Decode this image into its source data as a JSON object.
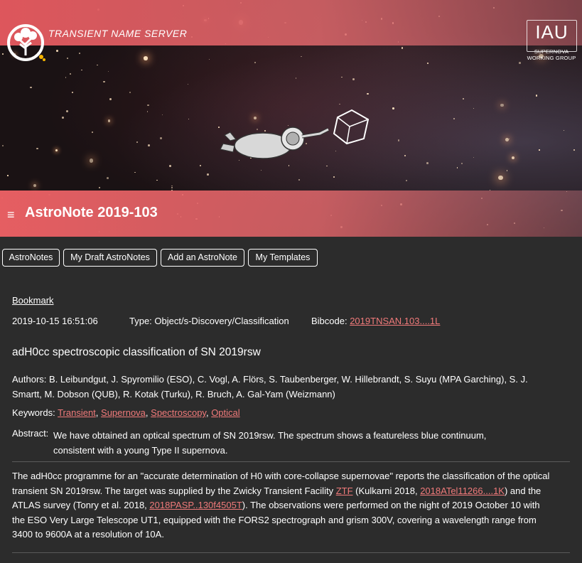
{
  "header": {
    "site_name": "TRANSIENT NAME SERVER",
    "iau_logo_text": "IAU",
    "iau_subtitle_line1": "SUPERNOVA",
    "iau_subtitle_line2": "WORKING GROUP",
    "page_title": "AstroNote 2019-103",
    "menu_icon": "≡"
  },
  "nav": {
    "buttons": [
      "AstroNotes",
      "My Draft AstroNotes",
      "Add an AstroNote",
      "My Templates"
    ]
  },
  "note": {
    "bookmark": "Bookmark",
    "datetime": "2019-10-15 16:51:06",
    "type": "Type: Object/s-Discovery/Classification",
    "bibcode_label": "Bibcode: ",
    "bibcode": "2019TNSAN.103....1L",
    "title": "adH0cc spectroscopic classification of SN 2019rsw",
    "authors_line1": "Authors: B. Leibundgut, J. Spyromilio (ESO), C. Vogl, A. Flörs, S. Taubenberger, W. Hillebrandt, S. Suyu (MPA Garching), S. J.",
    "authors_line2": "Smartt, M. Dobson (QUB), R. Kotak (Turku), R. Bruch, A. Gal-Yam (Weizmann)",
    "keywords_label": "Keywords: ",
    "keywords": [
      "Transient",
      "Supernova",
      "Spectroscopy",
      "Optical"
    ],
    "keyword_separator": ", ",
    "abstract_label": "Abstract:",
    "abstract_line1": "We have obtained an optical spectrum of SN 2019rsw. The spectrum shows a featureless blue continuum,",
    "abstract_line2": "consistent with a young Type II supernova.",
    "body": {
      "l1": "The adH0cc programme for an \"accurate determination of H0 with core-collapse supernovae\" reports the classification of the optical",
      "l2_a": "transient SN 2019rsw. The target was supplied by the Zwicky Transient Facility ",
      "l2_link1": "ZTF",
      "l2_b": " (Kulkarni 2018, ",
      "l2_link2": "2018ATel11266....1K",
      "l2_c": ") and the",
      "l3_a": "ATLAS survey (Tonry et al. 2018, ",
      "l3_link": "2018PASP..130f4505T",
      "l3_b": "). The observations were performed  on the night of 2019 October 10 with",
      "l4": "the ESO Very Large Telescope UT1, equipped with the FORS2 spectrograph and grism 300V, covering a wavelength range from",
      "l5": "3400 to 9600A at a resolution of 10A."
    }
  },
  "colors": {
    "accent": "#e85a60",
    "link": "#f07a7a",
    "background": "#2c2c2c"
  }
}
